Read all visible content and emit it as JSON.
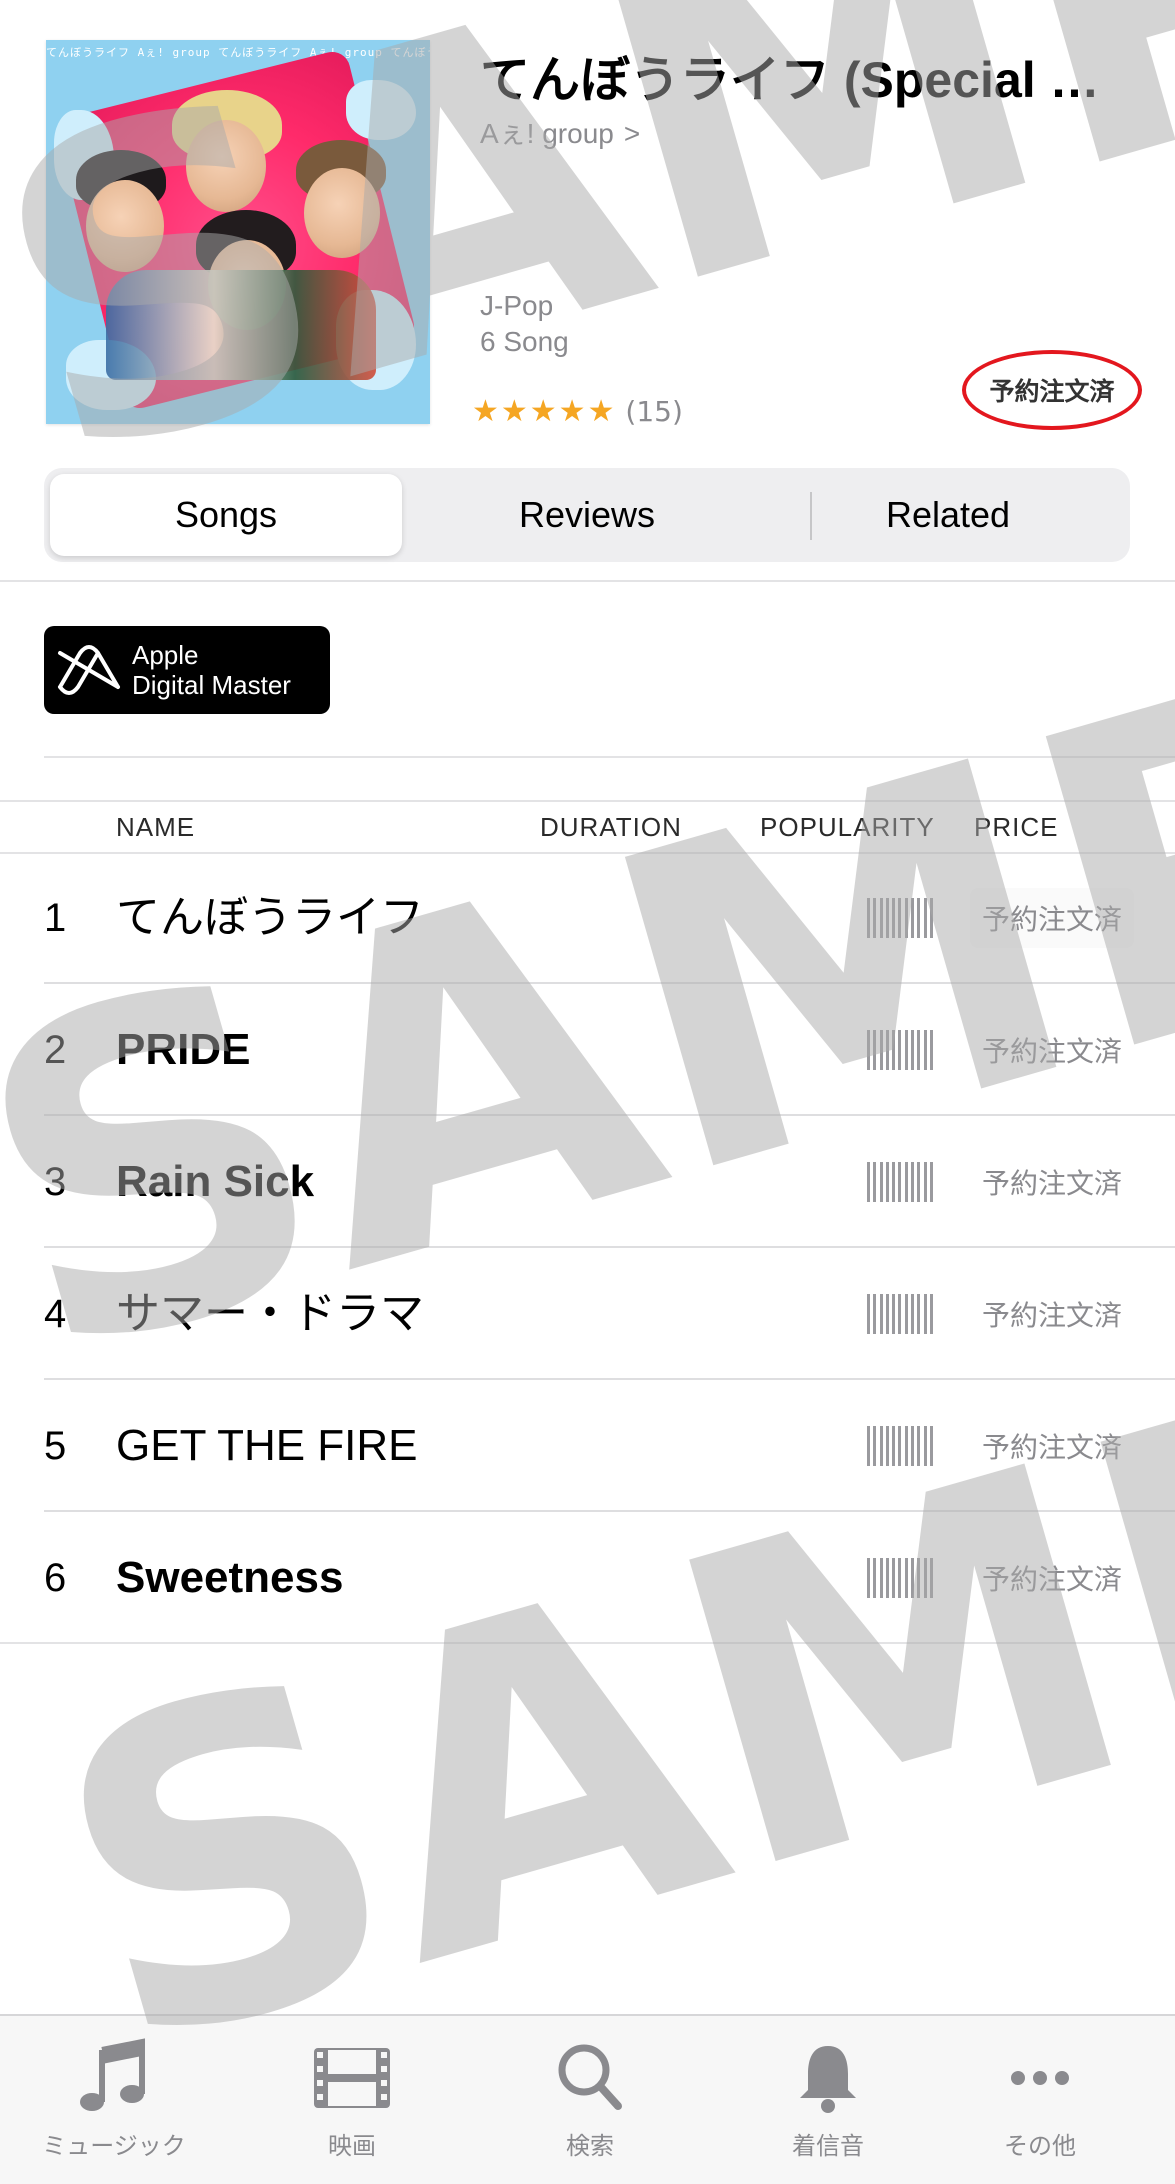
{
  "album": {
    "title": "てんぼうライフ (Special Edit…",
    "artist": "Aぇ! group",
    "artist_chevron": ">",
    "genre": "J-Pop",
    "song_count": "6 Song",
    "stars": "★★★★★",
    "rating_count": "(15)",
    "preorder_label": "予約注文済",
    "artwork_border_text": "てんぼうライフ Aぇ! group てんぼうライフ Aぇ! group てんぼうライフ"
  },
  "tabs_segment": {
    "songs": "Songs",
    "reviews": "Reviews",
    "related": "Related"
  },
  "badge": {
    "line1": "Apple",
    "line2": "Digital Master"
  },
  "columns": {
    "name": "NAME",
    "duration": "DURATION",
    "popularity": "POPULARITY",
    "price": "PRICE"
  },
  "tracks": [
    {
      "num": "1",
      "name": "てんぼうライフ",
      "price": "予約注文済"
    },
    {
      "num": "2",
      "name": "PRIDE",
      "price": "予約注文済"
    },
    {
      "num": "3",
      "name": "Rain Sick",
      "price": "予約注文済"
    },
    {
      "num": "4",
      "name": "サマー・ドラマ",
      "price": "予約注文済"
    },
    {
      "num": "5",
      "name": "GET THE FIRE",
      "price": "予約注文済"
    },
    {
      "num": "6",
      "name": "Sweetness",
      "price": "予約注文済"
    }
  ],
  "tabbar": {
    "music": "ミュージック",
    "movies": "映画",
    "search": "検索",
    "charts": "着信音",
    "more": "その他"
  },
  "watermark": "SAMPLE",
  "colors": {
    "preorder_ring": "#e3171e",
    "star": "#f5a623",
    "secondary_text": "#8a8a8e",
    "segment_bg": "#eeeef0"
  }
}
